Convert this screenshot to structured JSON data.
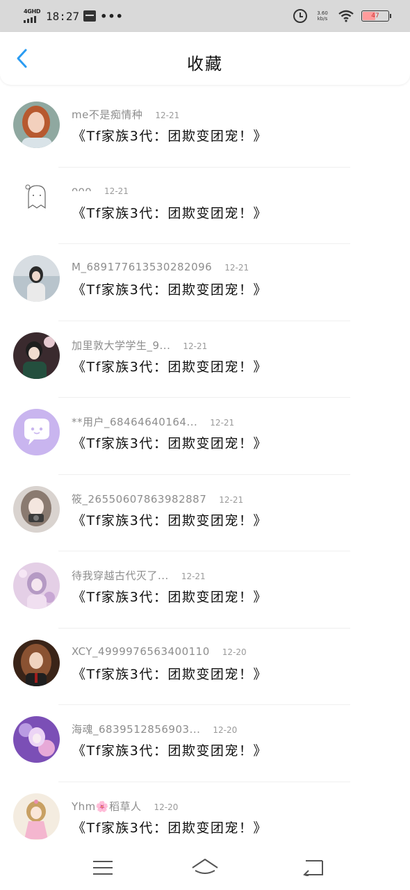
{
  "status_bar": {
    "network": "4GHD",
    "time": "18:27",
    "more": "•••",
    "net_speed_top": "3.60",
    "net_speed_bottom": "kb/s",
    "battery": "47",
    "battery_level": 0.47
  },
  "header": {
    "title": "收藏",
    "back_icon": "chevron-left-icon",
    "accent_color": "#2b9cf2"
  },
  "items": [
    {
      "username": "me不是痴情种",
      "date": "12-21",
      "title": "《Tf家族3代：团欺变团宠！》"
    },
    {
      "username": "ᴖᴖᴖ",
      "date": "12-21",
      "title": "《Tf家族3代：团欺变团宠！》"
    },
    {
      "username": "M_6891776135302820​96",
      "date": "12-21",
      "title": "《Tf家族3代：团欺变团宠！》"
    },
    {
      "username": "加里敦大学学生_9...",
      "date": "12-21",
      "title": "《Tf家族3代：团欺变团宠！》"
    },
    {
      "username": "**用户_68464640164...",
      "date": "12-21",
      "title": "《Tf家族3代：团欺变团宠！》"
    },
    {
      "username": "筱_26550607863982887",
      "date": "12-21",
      "title": "《Tf家族3代：团欺变团宠！》"
    },
    {
      "username": "待我穿越古代灭了...",
      "date": "12-21",
      "title": "《Tf家族3代：团欺变团宠！》"
    },
    {
      "username": "XCY_4999976563400110",
      "date": "12-20",
      "title": "《Tf家族3代：团欺变团宠！》"
    },
    {
      "username": "海魂_6839512856903...",
      "date": "12-20",
      "title": "《Tf家族3代：团欺变团宠！》"
    },
    {
      "username": "Yhm🌸稻草人",
      "date": "12-20",
      "title": "《Tf家族3代：团欺变团宠！》"
    }
  ],
  "nav": {
    "menu_icon": "menu-icon",
    "home_icon": "home-icon",
    "back_icon": "back-icon"
  }
}
